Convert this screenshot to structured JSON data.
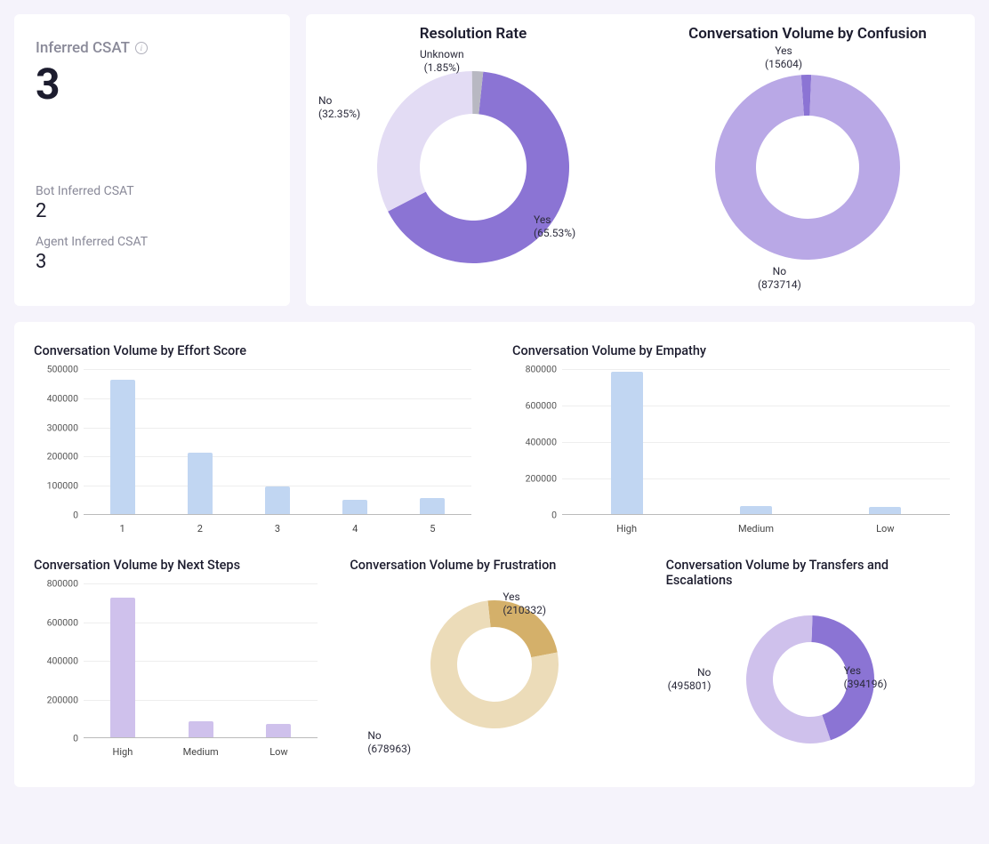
{
  "csat": {
    "title": "Inferred CSAT",
    "value": "3",
    "bot_label": "Bot Inferred CSAT",
    "bot_value": "2",
    "agent_label": "Agent Inferred CSAT",
    "agent_value": "3"
  },
  "colors": {
    "purple_dark": "#8b74d4",
    "purple_mid": "#b9a8e6",
    "purple_light": "#e3dcf4",
    "grey_seg": "#b8b8c2",
    "bar_blue": "#c1d6f2",
    "bar_purple": "#cfc1ec",
    "tan_light": "#ecdcb9",
    "tan_dark": "#d4b06a"
  },
  "chart_data": [
    {
      "id": "resolution_rate",
      "type": "donut",
      "title": "Resolution Rate",
      "series": [
        {
          "name": "Yes",
          "value": 65.53,
          "label": "Yes\n(65.53%)",
          "color": "#8b74d4"
        },
        {
          "name": "No",
          "value": 32.35,
          "label": "No\n(32.35%)",
          "color": "#e3dcf4"
        },
        {
          "name": "Unknown",
          "value": 1.85,
          "label": "Unknown\n(1.85%)",
          "color": "#b8b8c2"
        }
      ]
    },
    {
      "id": "confusion",
      "type": "donut",
      "title": "Conversation Volume by Confusion",
      "series": [
        {
          "name": "No",
          "value": 873714,
          "label": "No\n(873714)",
          "color": "#b9a8e6"
        },
        {
          "name": "Yes",
          "value": 15604,
          "label": "Yes\n(15604)",
          "color": "#8b74d4"
        }
      ]
    },
    {
      "id": "effort_score",
      "type": "bar",
      "title": "Conversation Volume by Effort Score",
      "categories": [
        "1",
        "2",
        "3",
        "4",
        "5"
      ],
      "values": [
        460000,
        210000,
        95000,
        50000,
        55000
      ],
      "ylim": [
        0,
        500000
      ],
      "ystep": 100000,
      "bar_color": "#c1d6f2"
    },
    {
      "id": "empathy",
      "type": "bar",
      "title": "Conversation Volume by Empathy",
      "categories": [
        "High",
        "Medium",
        "Low"
      ],
      "values": [
        780000,
        45000,
        40000
      ],
      "ylim": [
        0,
        800000
      ],
      "ystep": 200000,
      "bar_color": "#c1d6f2"
    },
    {
      "id": "next_steps",
      "type": "bar",
      "title": "Conversation Volume by Next Steps",
      "categories": [
        "High",
        "Medium",
        "Low"
      ],
      "values": [
        720000,
        85000,
        70000
      ],
      "ylim": [
        0,
        800000
      ],
      "ystep": 200000,
      "bar_color": "#cfc1ec"
    },
    {
      "id": "frustration",
      "type": "donut",
      "title": "Conversation Volume by Frustration",
      "series": [
        {
          "name": "Yes",
          "value": 210332,
          "label": "Yes\n(210332)",
          "color": "#d4b06a"
        },
        {
          "name": "No",
          "value": 678963,
          "label": "No\n(678963)",
          "color": "#ecdcb9"
        }
      ]
    },
    {
      "id": "transfers",
      "type": "donut",
      "title": "Conversation Volume by Transfers and Escalations",
      "series": [
        {
          "name": "Yes",
          "value": 394196,
          "label": "Yes\n(394196)",
          "color": "#8b74d4"
        },
        {
          "name": "No",
          "value": 495801,
          "label": "No\n(495801)",
          "color": "#cfc1ec"
        }
      ]
    }
  ]
}
